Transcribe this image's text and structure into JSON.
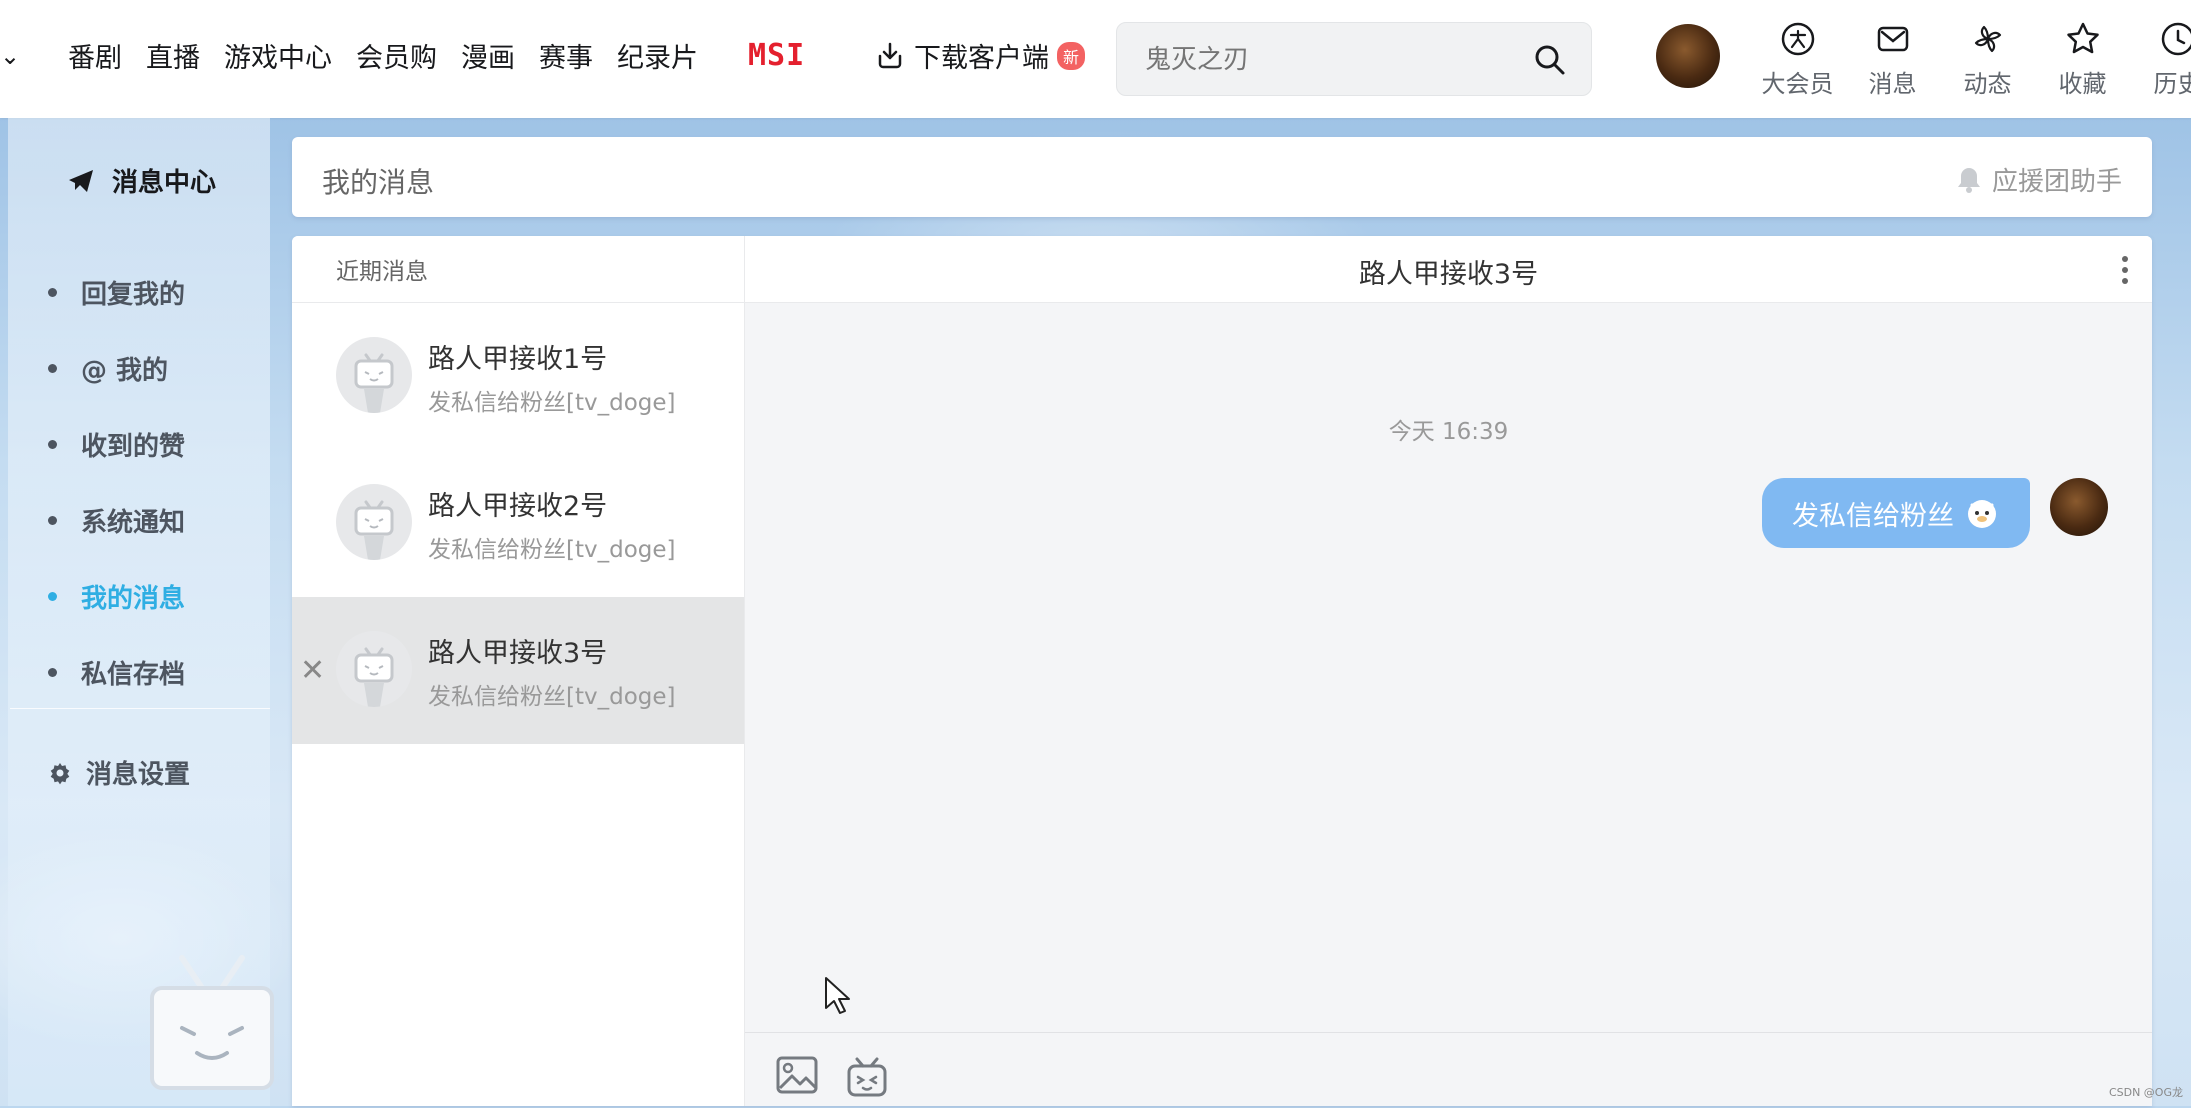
{
  "nav": {
    "items": [
      "番剧",
      "直播",
      "游戏中心",
      "会员购",
      "漫画",
      "赛事",
      "纪录片"
    ],
    "msi_logo": "MSI",
    "download_label": "下载客户端",
    "download_badge": "新"
  },
  "search": {
    "placeholder": "鬼灭之刃"
  },
  "top_right": {
    "vip": "大会员",
    "messages": "消息",
    "dynamic": "动态",
    "favorites": "收藏",
    "history": "历史"
  },
  "sidebar": {
    "title": "消息中心",
    "items": [
      {
        "label": "回复我的",
        "active": false
      },
      {
        "label": "@ 我的",
        "active": false
      },
      {
        "label": "收到的赞",
        "active": false
      },
      {
        "label": "系统通知",
        "active": false
      },
      {
        "label": "我的消息",
        "active": true
      },
      {
        "label": "私信存档",
        "active": false
      }
    ],
    "settings": "消息设置"
  },
  "header": {
    "title": "我的消息",
    "assistant": "应援团助手"
  },
  "conversations": {
    "heading": "近期消息",
    "items": [
      {
        "name": "路人甲接收1号",
        "preview": "发私信给粉丝[tv_doge]"
      },
      {
        "name": "路人甲接收2号",
        "preview": "发私信给粉丝[tv_doge]"
      },
      {
        "name": "路人甲接收3号",
        "preview": "发私信给粉丝[tv_doge]"
      }
    ]
  },
  "chat": {
    "title": "路人甲接收3号",
    "timestamp": "今天 16:39",
    "message": "发私信给粉丝"
  },
  "watermark": "CSDN @OG龙",
  "colors": {
    "accent": "#2faee3",
    "bubble": "#80b9f2",
    "msi_red": "#e4202e"
  }
}
